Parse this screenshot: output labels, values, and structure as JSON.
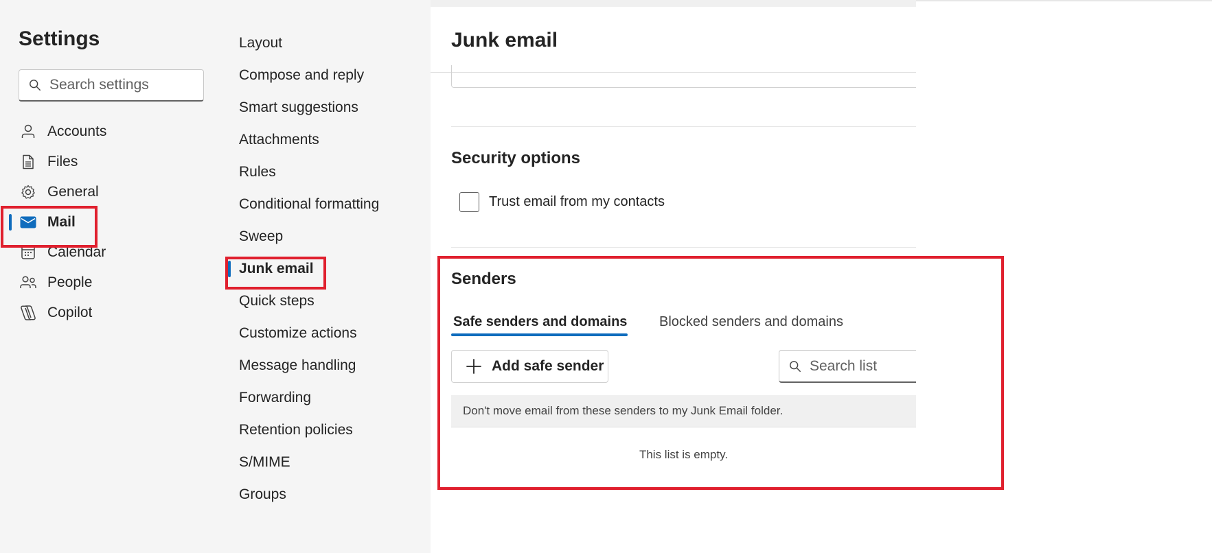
{
  "settings": {
    "title": "Settings",
    "search_placeholder": "Search settings",
    "nav_items": [
      {
        "label": "Accounts",
        "icon": "person-icon"
      },
      {
        "label": "Files",
        "icon": "document-icon"
      },
      {
        "label": "General",
        "icon": "gear-icon"
      },
      {
        "label": "Mail",
        "icon": "mail-icon",
        "active": true
      },
      {
        "label": "Calendar",
        "icon": "calendar-icon"
      },
      {
        "label": "People",
        "icon": "people-icon"
      },
      {
        "label": "Copilot",
        "icon": "copilot-icon"
      }
    ]
  },
  "mail_categories": [
    "Layout",
    "Compose and reply",
    "Smart suggestions",
    "Attachments",
    "Rules",
    "Conditional formatting",
    "Sweep",
    "Junk email",
    "Quick steps",
    "Customize actions",
    "Message handling",
    "Forwarding",
    "Retention policies",
    "S/MIME",
    "Groups"
  ],
  "active_category": "Junk email",
  "content": {
    "title": "Junk email",
    "security": {
      "title": "Security options",
      "trust_contacts_label": "Trust email from my contacts",
      "trust_contacts_checked": false
    },
    "senders": {
      "title": "Senders",
      "tabs": [
        "Safe senders and domains",
        "Blocked senders and domains"
      ],
      "active_tab": "Safe senders and domains",
      "add_button": "Add safe sender",
      "search_placeholder": "Search list",
      "list_header": "Don't move email from these senders to my Junk Email folder.",
      "empty_text": "This list is empty."
    }
  },
  "colors": {
    "accent": "#0f6cbd",
    "highlight": "#e0202e",
    "nav_background": "#f5f5f5"
  }
}
